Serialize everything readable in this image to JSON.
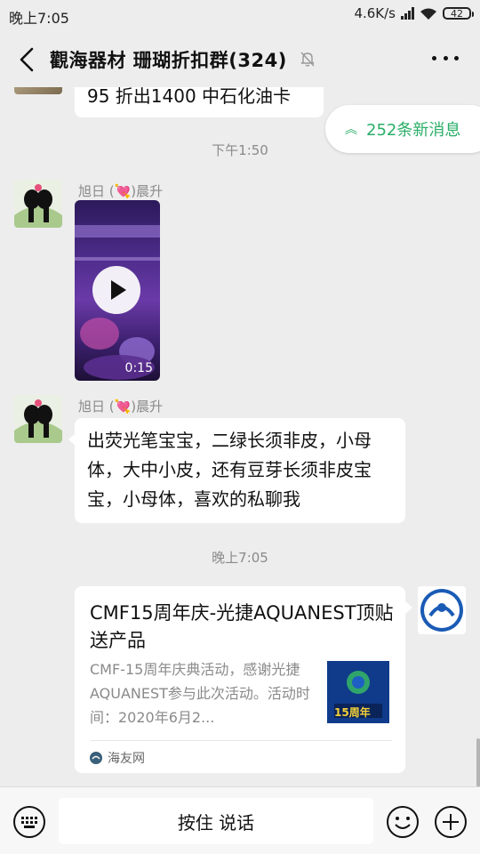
{
  "status_bar": {
    "time": "晚上7:05",
    "network_speed": "4.6K/s",
    "battery": "42"
  },
  "header": {
    "title": "觀海器材 珊瑚折扣群(324)"
  },
  "new_messages": {
    "label": "252条新消息"
  },
  "messages": [
    {
      "type": "text",
      "text": "95 折出1400 中石化油卡"
    },
    {
      "type": "timestamp",
      "text": "下午1:50"
    },
    {
      "type": "video",
      "sender": "旭日 (💘)晨升",
      "duration": "0:15"
    },
    {
      "type": "text",
      "sender": "旭日 (💘)晨升",
      "text": "出荧光笔宝宝，二绿长须非皮，小母体，大中小皮，还有豆芽长须非皮宝宝，小母体，喜欢的私聊我"
    },
    {
      "type": "timestamp",
      "text": "晚上7:05"
    },
    {
      "type": "link_card",
      "title": "CMF15周年庆-光捷AQUANEST顶贴送产品",
      "description": "CMF-15周年庆典活动，感谢光捷AQUANEST参与此次活动。活动时间：2020年6月2...",
      "source": "海友网",
      "thumb_label": "15周年"
    }
  ],
  "input_bar": {
    "talk_label": "按住 说话"
  },
  "colors": {
    "background": "#ededed",
    "accent_green": "#2aae67",
    "bubble": "#ffffff"
  }
}
